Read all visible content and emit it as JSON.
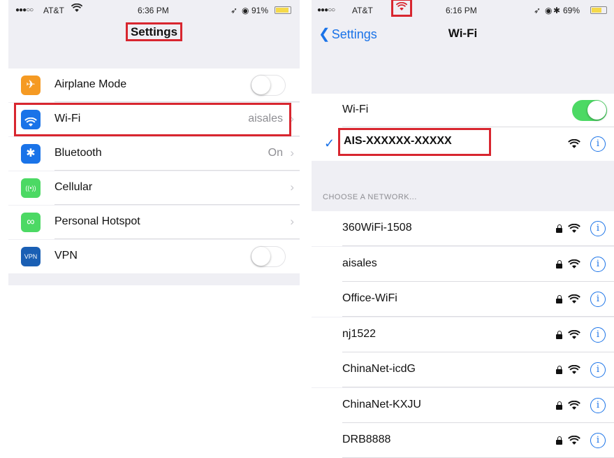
{
  "left": {
    "status": {
      "carrier": "AT&T",
      "time": "6:36 PM",
      "battery": "91%",
      "battery_level": 0.91
    },
    "title": "Settings",
    "items": [
      {
        "label": "Airplane Mode",
        "icon": "airplane-icon",
        "icon_glyph": "✈",
        "color": "#f59a23",
        "control": "toggle",
        "toggle_on": false
      },
      {
        "label": "Wi-Fi",
        "icon": "wifi-icon",
        "color": "#1a73e8",
        "control": "value",
        "value": "aisales"
      },
      {
        "label": "Bluetooth",
        "icon": "bluetooth-icon",
        "icon_glyph": "✱",
        "color": "#1a73e8",
        "control": "value",
        "value": "On"
      },
      {
        "label": "Cellular",
        "icon": "cellular-icon",
        "icon_glyph": "((•))",
        "color": "#4cd964",
        "control": "chevron"
      },
      {
        "label": "Personal Hotspot",
        "icon": "hotspot-icon",
        "icon_glyph": "∞",
        "color": "#4cd964",
        "control": "chevron"
      },
      {
        "label": "VPN",
        "icon": "vpn-icon",
        "icon_glyph": "VPN",
        "color": "#1a5fb4",
        "control": "toggle",
        "toggle_on": false
      }
    ]
  },
  "right": {
    "status": {
      "carrier": "AT&T",
      "time": "6:16 PM",
      "battery": "69%",
      "battery_level": 0.69
    },
    "back_label": "Settings",
    "title": "Wi-Fi",
    "wifi_label": "Wi-Fi",
    "wifi_on": true,
    "connected_network": "AIS-XXXXXX-XXXXX",
    "section_header": "CHOOSE A NETWORK...",
    "networks": [
      {
        "name": "360WiFi-1508",
        "locked": true
      },
      {
        "name": "aisales",
        "locked": true
      },
      {
        "name": "Office-WiFi",
        "locked": true
      },
      {
        "name": "nj1522",
        "locked": true
      },
      {
        "name": "ChinaNet-icdG",
        "locked": true
      },
      {
        "name": "ChinaNet-KXJU",
        "locked": true
      },
      {
        "name": "DRB8888",
        "locked": true
      }
    ],
    "info_glyph": "i"
  },
  "colors": {
    "highlight": "#d8262f",
    "accent": "#1a73e8",
    "switch_on": "#4cd964"
  }
}
